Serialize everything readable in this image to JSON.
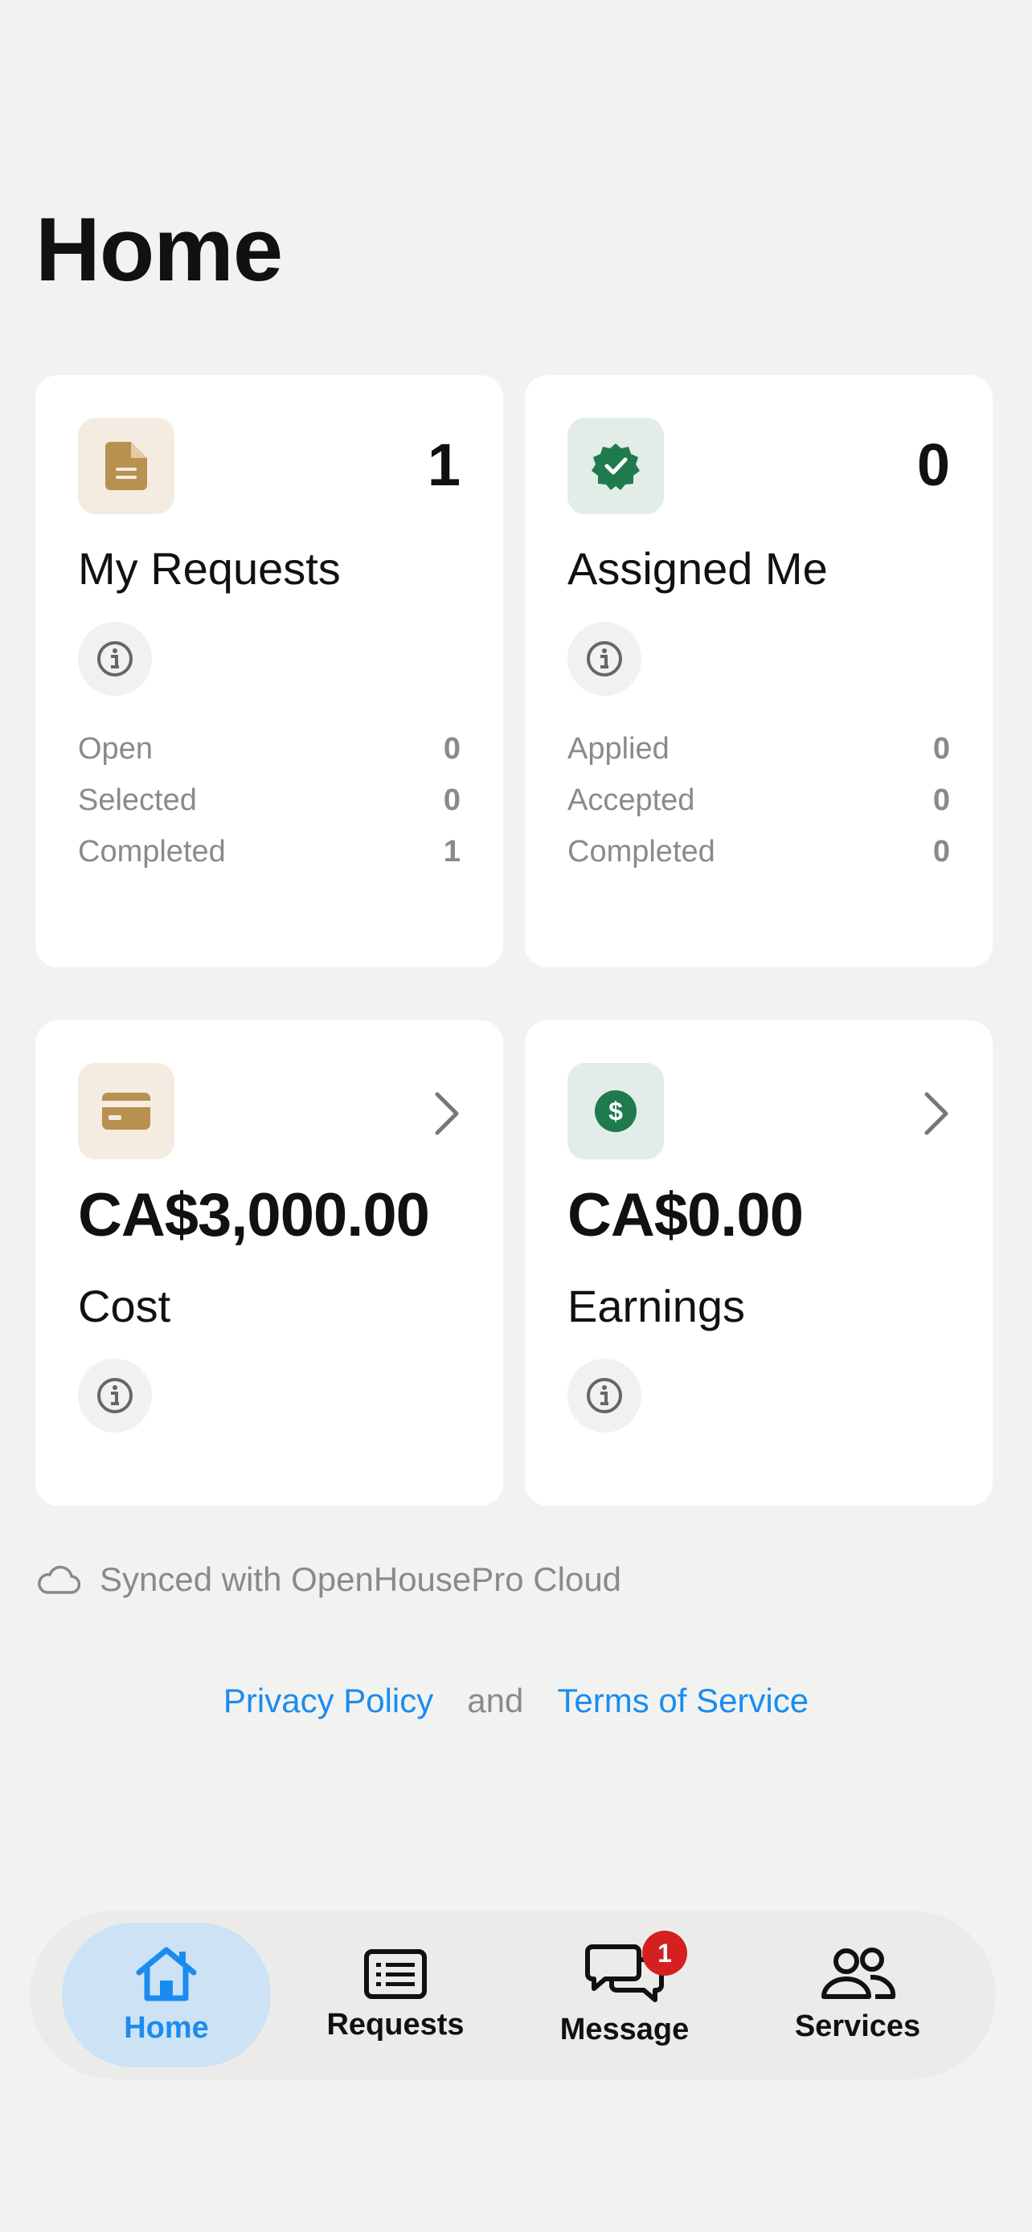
{
  "header": {
    "title": "Home"
  },
  "cards": {
    "my_requests": {
      "count": "1",
      "title": "My Requests",
      "icon": "document-icon",
      "stats": [
        {
          "label": "Open",
          "value": "0"
        },
        {
          "label": "Selected",
          "value": "0"
        },
        {
          "label": "Completed",
          "value": "1"
        }
      ]
    },
    "assigned_me": {
      "count": "0",
      "title": "Assigned Me",
      "icon": "verified-badge-icon",
      "stats": [
        {
          "label": "Applied",
          "value": "0"
        },
        {
          "label": "Accepted",
          "value": "0"
        },
        {
          "label": "Completed",
          "value": "0"
        }
      ]
    },
    "cost": {
      "amount": "CA$3,000.00",
      "title": "Cost",
      "icon": "credit-card-icon"
    },
    "earnings": {
      "amount": "CA$0.00",
      "title": "Earnings",
      "icon": "dollar-coin-icon"
    }
  },
  "sync": {
    "text": "Synced with OpenHousePro Cloud"
  },
  "legal": {
    "privacy": "Privacy Policy",
    "and": "and",
    "terms": "Terms of Service"
  },
  "tabbar": {
    "home": "Home",
    "requests": "Requests",
    "message": "Message",
    "message_badge": "1",
    "services": "Services"
  },
  "colors": {
    "accent_blue": "#1a8cf0",
    "tan_icon": "#b8904f",
    "green_icon": "#1f7a4d",
    "badge_red": "#d42020"
  }
}
